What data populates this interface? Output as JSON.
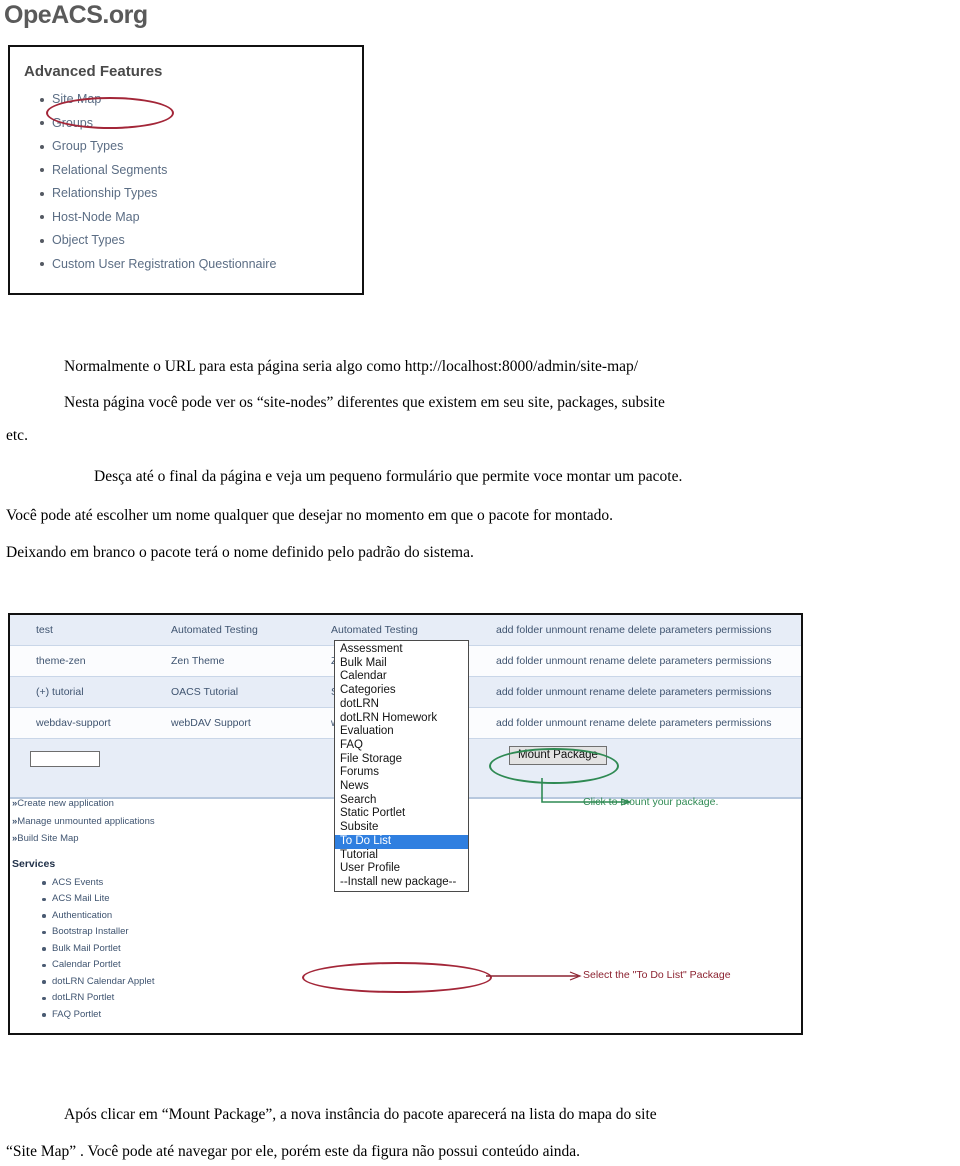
{
  "brand": {
    "name": "OpeACS.org"
  },
  "screenshot_advanced_features": {
    "panel_title": "Advanced Features",
    "items": [
      {
        "label": "Site Map",
        "highlighted": true
      },
      {
        "label": "Groups",
        "highlighted": false
      },
      {
        "label": "Group Types",
        "highlighted": false
      },
      {
        "label": "Relational Segments",
        "highlighted": false
      },
      {
        "label": "Relationship Types",
        "highlighted": false
      },
      {
        "label": "Host-Node Map",
        "highlighted": false
      },
      {
        "label": "Object Types",
        "highlighted": false
      },
      {
        "label": "Custom User Registration Questionnaire",
        "highlighted": false
      }
    ]
  },
  "body_text": {
    "p1_line1": "Normalmente o URL para esta página seria algo como http://localhost:8000/admin/site-map/",
    "p1_line2": "Nesta página você pode ver os “site-nodes” diferentes que existem em seu site, packages, subsite",
    "p1_line3": "etc.",
    "p2_line1": "Desça até o final da página e veja um pequeno formulário que permite voce montar um pacote.",
    "p2_line2": "Você pode até escolher um nome qualquer que desejar no momento em que o pacote for montado.",
    "p2_line3": "Deixando em branco o pacote terá o nome definido pelo padrão do sistema.",
    "p3_line1": "Após clicar em “Mount Package”, a nova instância do pacote aparecerá na lista do mapa do site",
    "p3_line2": "“Site Map” . Você pode até navegar por ele, porém este da figura não possui conteúdo ainda."
  },
  "screenshot_site_map": {
    "table": {
      "rows": [
        {
          "key": "test",
          "name": "Automated Testing",
          "type": "Automated Testing",
          "actions": "add folder unmount rename delete parameters permissions"
        },
        {
          "key": "theme-zen",
          "name": "Zen Theme",
          "type": "Zen Theme",
          "actions": "add folder unmount rename delete parameters permissions"
        },
        {
          "key": "(+) tutorial",
          "name": "OACS Tutorial",
          "type": "Subsite",
          "actions": "add folder unmount rename delete parameters permissions"
        },
        {
          "key": "webdav-support",
          "name": "webDAV Support",
          "type": "webDAV Support",
          "actions": "add folder unmount rename delete parameters permissions"
        }
      ]
    },
    "form": {
      "name_input_value": "",
      "select_value": "Assessment",
      "mount_button_label": "Mount Package",
      "dropdown_arrow_icon": "chevron-down-icon",
      "options": [
        "Assessment",
        "Bulk Mail",
        "Calendar",
        "Categories",
        "dotLRN",
        "dotLRN Homework",
        "Evaluation",
        "FAQ",
        "File Storage",
        "Forums",
        "News",
        "Search",
        "Static Portlet",
        "Subsite",
        "To Do List",
        "Tutorial",
        "User Profile",
        "--Install new package--"
      ],
      "selected_option": "To Do List"
    },
    "left_nav": {
      "links": [
        "Create new application",
        "Manage unmounted applications",
        "Build Site Map"
      ],
      "services_title": "Services",
      "services": [
        "ACS Events",
        "ACS Mail Lite",
        "Authentication",
        "Bootstrap Installer",
        "Bulk Mail Portlet",
        "Calendar Portlet",
        "dotLRN Calendar Applet",
        "dotLRN Portlet",
        "FAQ Portlet"
      ]
    },
    "annotations": {
      "mount_note": "Click to mount your package.",
      "select_note": "Select the \"To Do List\"  Package"
    }
  },
  "colors": {
    "annotation_red": "#a32638",
    "annotation_green": "#2f8a53",
    "table_row_odd": "#e7edf7",
    "table_row_even": "#fbfcfe",
    "link_blue": "#3f5470",
    "option_selected_bg": "#2f7fe0"
  }
}
